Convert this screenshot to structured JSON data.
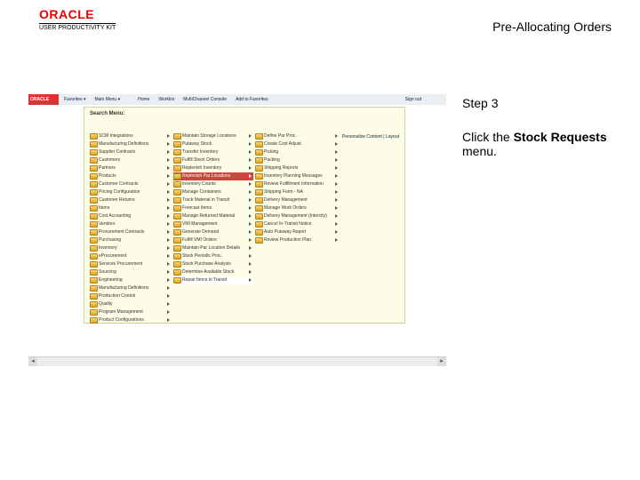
{
  "header": {
    "logo_main": "ORACLE",
    "logo_sub": "USER PRODUCTIVITY KIT",
    "title": "Pre-Allocating Orders"
  },
  "instruction": {
    "step": "Step 3",
    "prefix": "Click the ",
    "bold": "Stock Requests",
    "suffix": " menu."
  },
  "screenshot": {
    "brand": "ORACLE",
    "topnav": [
      "Favorites ▾",
      "Main Menu ▾",
      "",
      "",
      "Home",
      "Worklist",
      "MultiChannel Console",
      "Add to Favorites",
      "Sign out"
    ],
    "panel_title": "Search Menu:",
    "personalize": "Personalize Content | Layout",
    "col1": [
      "SCM Integrations",
      "Manufacturing Definitions",
      "Supplier Contracts",
      "Customers",
      "Partners",
      "Products",
      "Customer Contracts",
      "Pricing Configuration",
      "Customer Returns",
      "Items",
      "Cost Accounting",
      "Vendors",
      "Procurement Contracts",
      "Purchasing",
      "Inventory",
      "eProcurement",
      "Services Procurement",
      "Sourcing",
      "Engineering",
      "Manufacturing Definitions",
      "Production Control",
      "Quality",
      "Program Management",
      "Product Configurations"
    ],
    "col2": [
      "Maintain Storage Locations",
      "Putaway Stock",
      "Transfer Inventory",
      "Fulfill Stock Orders",
      "Replenish Inventory",
      "Replenish Par Locations",
      "Inventory Counts",
      "Manage Containers",
      "Track Material in Transit",
      "Forecast Items",
      "Manage Returned Material",
      "VMI Management",
      "Generate Demand",
      "Fulfill VMI Orders",
      "Maintain Par Location Details",
      "Stock Periodic Proc.",
      "Stock Purchase Analysis",
      "Determine Available Stock",
      "Repair Items in Transit"
    ],
    "col2_hl_index": 5,
    "col2_sel_index": 18,
    "col3": [
      "Define Par Proc.",
      "Create Cost Adjust.",
      "Picking",
      "Packing",
      "Shipping Reports",
      "Inventory Planning Messages",
      "Review Fulfillment Information",
      "Shipping Form - NA",
      "Delivery Management",
      "Manage Work Orders",
      "Delivery Management (Intercity)",
      "Cancel In-Transit Notice",
      "Auto Putaway Report",
      "Review Production Plan"
    ]
  }
}
